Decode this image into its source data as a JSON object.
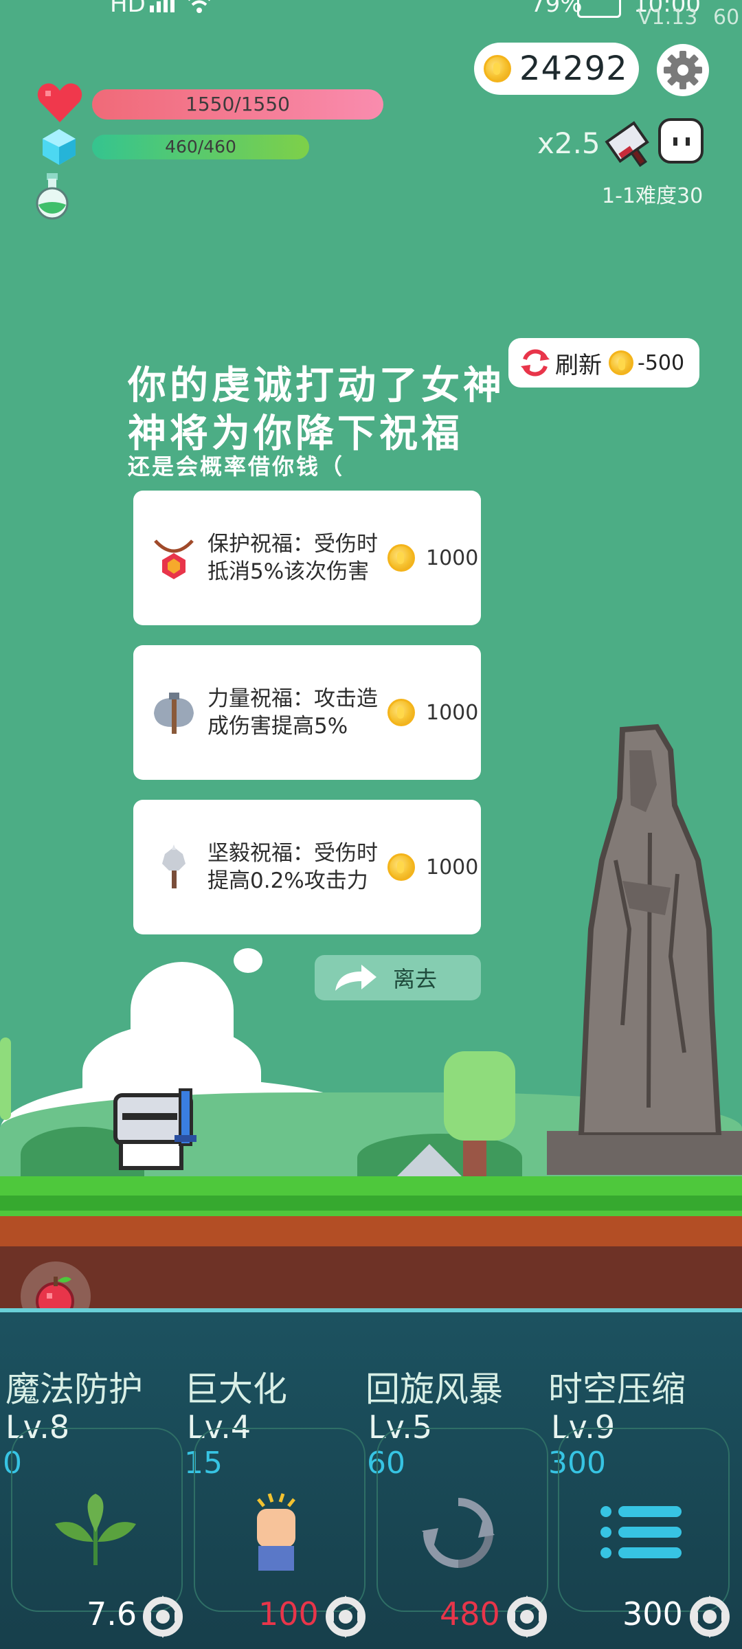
{
  "status_bar": {
    "network_label": "HD",
    "battery_percent": "79%",
    "clock": "10:00",
    "version": "V1.13",
    "fps": "60"
  },
  "hud": {
    "coins": "24292",
    "hp_text": "1550/1550",
    "hp_fraction": 1.0,
    "mp_text": "460/460",
    "mp_fraction": 1.0,
    "multiplier": "x2.5",
    "stage": "1-1难度30"
  },
  "refresh": {
    "label": "刷新",
    "cost": "-500"
  },
  "dialog": {
    "title_line1": "你的虔诚打动了女神",
    "title_line2": "神将为你降下祝福",
    "subtitle": "还是会概率借你钱（"
  },
  "blessings": [
    {
      "icon": "amulet-icon",
      "line1": "保护祝福：受伤时",
      "line2": "抵消5%该次伤害",
      "price": "1000"
    },
    {
      "icon": "battle-axe-icon",
      "line1": "力量祝福：攻击造",
      "line2": "成伤害提高5%",
      "price": "1000"
    },
    {
      "icon": "mace-icon",
      "line1": "坚毅祝福：受伤时",
      "line2": "提高0.2%攻击力",
      "price": "1000"
    }
  ],
  "leave_label": "离去",
  "skills": [
    {
      "name": "魔法防护",
      "level": "Lv.8",
      "cost": "0",
      "cooldown": "7.6",
      "cooldown_color": "#ffffff",
      "icon": "leaf-icon"
    },
    {
      "name": "巨大化",
      "level": "Lv.4",
      "cost": "15",
      "cooldown": "100",
      "cooldown_color": "#e8354a",
      "icon": "fist-icon"
    },
    {
      "name": "回旋风暴",
      "level": "Lv.5",
      "cost": "60",
      "cooldown": "480",
      "cooldown_color": "#e8354a",
      "icon": "whirlwind-icon"
    },
    {
      "name": "时空压缩",
      "level": "Lv.9",
      "cost": "300",
      "cooldown": "300",
      "cooldown_color": "#ffffff",
      "icon": "list-icon"
    }
  ],
  "colors": {
    "background": "#4cad85",
    "hp_bar": "#f37485",
    "mp_bar": "#4cc77b",
    "cost_blue": "#37c4e3"
  }
}
